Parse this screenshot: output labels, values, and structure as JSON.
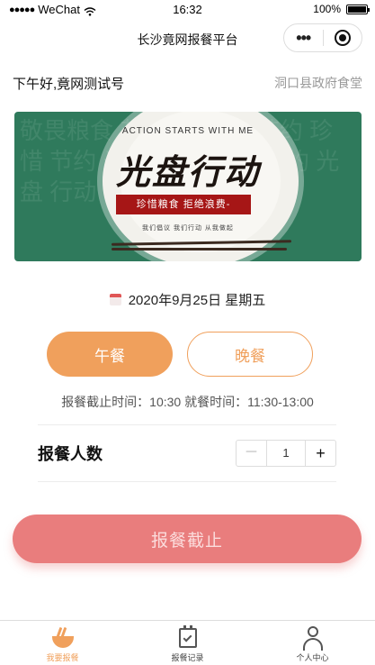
{
  "status_bar": {
    "carrier": "WeChat",
    "signal_dots": "●●●●●",
    "time": "16:32",
    "battery_text": "100%",
    "battery_level": 1.0
  },
  "nav": {
    "title": "长沙竟网报餐平台",
    "more_glyph": "•••"
  },
  "header": {
    "greeting": "下午好,竟网测试号",
    "canteen": "洞口县政府食堂"
  },
  "banner": {
    "header_text": "ACTION STARTS WITH ME",
    "title": "光盘行动",
    "tag": "珍惜粮食 拒绝浪费-",
    "slogan": "我们倡议 我们行动 从我做起",
    "background_chars": "敬畏粮食 节约 光盘 动 节约 珍惜 节约 光盘 珍惜 敬畏 节约 光盘 行动"
  },
  "date": {
    "text": "2020年9月25日 星期五"
  },
  "meals": {
    "lunch_label": "午餐",
    "dinner_label": "晚餐",
    "selected": "lunch"
  },
  "times": {
    "text": "报餐截止时间：10:30 就餐时间：11:30-13:00"
  },
  "count": {
    "label": "报餐人数",
    "minus": "－",
    "value": "1",
    "plus": "+"
  },
  "submit": {
    "label": "报餐截止"
  },
  "tabbar": {
    "tabs": [
      {
        "label": "我要报餐",
        "icon": "bowl-icon",
        "active": true
      },
      {
        "label": "报餐记录",
        "icon": "clipboard-check-icon",
        "active": false
      },
      {
        "label": "个人中心",
        "icon": "person-icon",
        "active": false
      }
    ]
  },
  "colors": {
    "accent": "#f0a05c",
    "submit": "#e97d7d",
    "banner_green": "#2f7a5c",
    "banner_red": "#a61616"
  }
}
